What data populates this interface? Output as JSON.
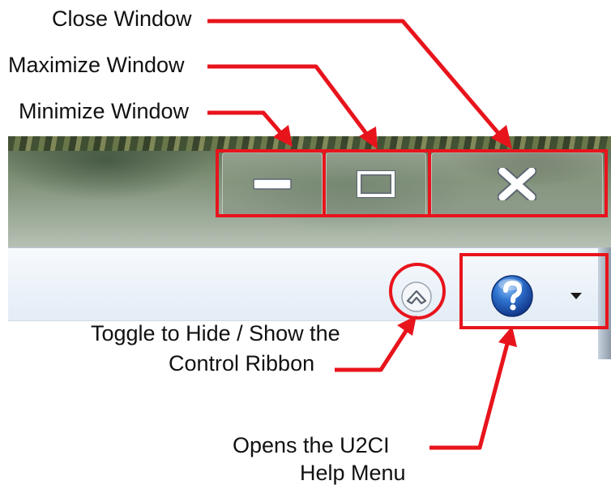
{
  "annotations": {
    "close": "Close Window",
    "maximize": "Maximize Window",
    "minimize": "Minimize Window",
    "toggle_line1": "Toggle to Hide / Show the",
    "toggle_line2": "Control Ribbon",
    "help_line1": "Opens the U2CI",
    "help_line2": "Help Menu"
  },
  "icons": {
    "minimize": "minimize-icon",
    "maximize": "maximize-icon",
    "close": "close-icon",
    "toggle": "chevron-up-icon",
    "help": "help-icon",
    "dropdown": "caret-down-icon"
  },
  "colors": {
    "highlight": "#e8141c",
    "help_blue": "#1f5fbf"
  }
}
